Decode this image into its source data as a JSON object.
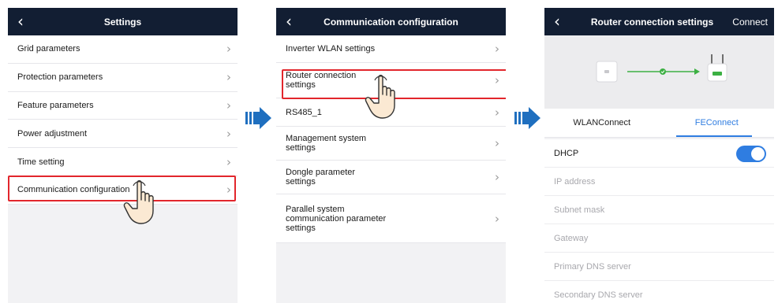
{
  "screen1": {
    "title": "Settings",
    "items": [
      {
        "label": "Grid parameters"
      },
      {
        "label": "Protection parameters"
      },
      {
        "label": "Feature parameters"
      },
      {
        "label": "Power adjustment"
      },
      {
        "label": "Time setting"
      },
      {
        "label": "Communication configuration"
      }
    ]
  },
  "screen2": {
    "title": "Communication configuration",
    "items": [
      {
        "label": "Inverter WLAN settings"
      },
      {
        "label": "Router connection settings"
      },
      {
        "label": "RS485_1"
      },
      {
        "label": "Management system settings"
      },
      {
        "label": "Dongle parameter settings"
      },
      {
        "label": "Parallel system communication parameter settings"
      }
    ]
  },
  "screen3": {
    "title": "Router connection settings",
    "action": "Connect",
    "tabs": [
      "WLANConnect",
      "FEConnect"
    ],
    "active_tab": "FEConnect",
    "dhcp_label": "DHCP",
    "dhcp_enabled": true,
    "fields": [
      {
        "label": "IP address"
      },
      {
        "label": "Subnet mask"
      },
      {
        "label": "Gateway"
      },
      {
        "label": "Primary DNS server"
      },
      {
        "label": "Secondary DNS server"
      }
    ]
  },
  "colors": {
    "header_bg": "#121e33",
    "highlight": "#e2262c",
    "accent": "#2f7de1",
    "arrow": "#1f6fbf",
    "connection_line": "#3cb043"
  },
  "icons": [
    "back-chevron-icon",
    "chevron-right-icon",
    "tap-hand-icon",
    "flow-arrow-icon",
    "inverter-icon",
    "router-icon",
    "connection-check-icon"
  ]
}
